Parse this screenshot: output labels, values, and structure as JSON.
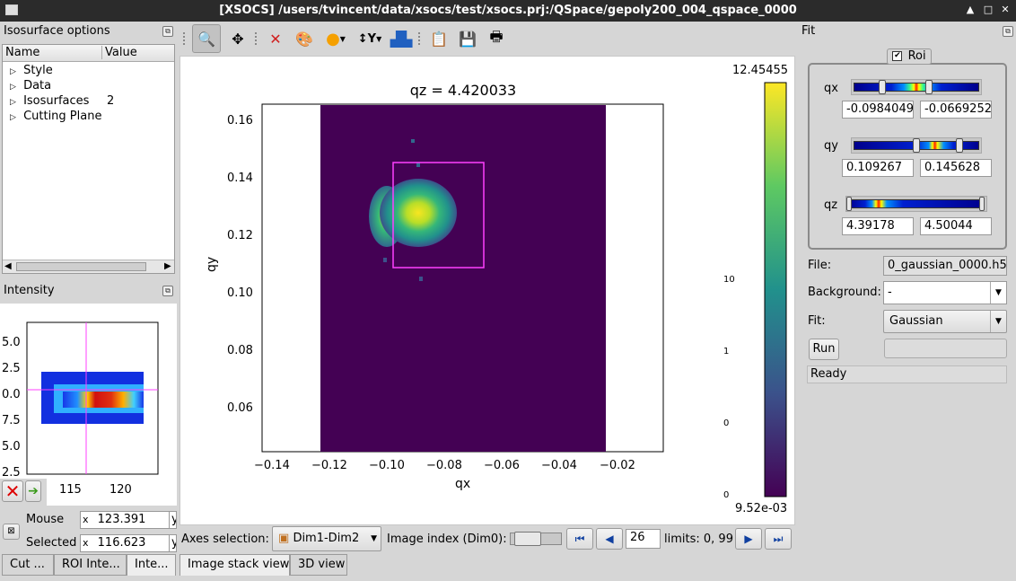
{
  "window": {
    "title": "[XSOCS] /users/tvincent/data/xsocs/test/xsocs.prj:/QSpace/gepoly200_004_qspace_0000"
  },
  "left": {
    "iso_title": "Isosurface options",
    "col_name": "Name",
    "col_value": "Value",
    "tree": [
      {
        "label": "Style",
        "value": ""
      },
      {
        "label": "Data",
        "value": ""
      },
      {
        "label": "Isosurfaces",
        "value": "2"
      },
      {
        "label": "Cutting Plane",
        "value": ""
      }
    ],
    "intensity_title": "Intensity",
    "y_ticks": [
      "5.0",
      "2.5",
      "0.0",
      "7.5",
      "5.0",
      "2.5"
    ],
    "x_ticks": [
      "115",
      "120"
    ],
    "mouse_label": "Mouse",
    "mouse_value": "123.391",
    "selected_label": "Selected",
    "selected_value": "116.623",
    "y_stub": "y",
    "tabs": [
      "Cut ...",
      "ROI Inte...",
      "Inte..."
    ]
  },
  "plot": {
    "title": "qz = 4.420033",
    "xlabel": "qx",
    "ylabel": "qy",
    "x_ticks": [
      "−0.14",
      "−0.12",
      "−0.10",
      "−0.08",
      "−0.06",
      "−0.04",
      "−0.02"
    ],
    "y_ticks": [
      "0.16",
      "0.14",
      "0.12",
      "0.10",
      "0.08",
      "0.06"
    ],
    "colorbar_max": "12.45455",
    "colorbar_min": "9.52e-03",
    "colorbar_ticks": [
      "10",
      "1",
      "0",
      "0"
    ]
  },
  "bottom": {
    "axes_label": "Axes selection:",
    "axes_value": "Dim1-Dim2",
    "index_label": "Image index (Dim0):",
    "index_value": "26",
    "limits": "limits: 0, 99",
    "tabs": [
      "Image stack view",
      "3D view"
    ]
  },
  "fit": {
    "title": "Fit",
    "roi_label": "Roi",
    "qx_label": "qx",
    "qx_min": "-0.0984049",
    "qx_max": "-0.0669252",
    "qy_label": "qy",
    "qy_min": "0.109267",
    "qy_max": "0.145628",
    "qz_label": "qz",
    "qz_min": "4.39178",
    "qz_max": "4.50044",
    "file_label": "File:",
    "file_value": "0_gaussian_0000.h5",
    "bg_label": "Background:",
    "bg_value": "-",
    "fit_label": "Fit:",
    "fit_value": "Gaussian",
    "run_label": "Run",
    "status": "Ready"
  }
}
